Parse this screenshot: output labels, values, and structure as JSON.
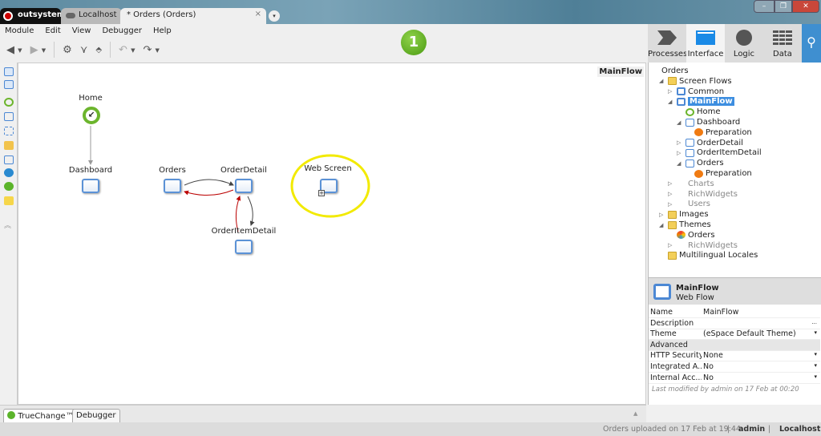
{
  "window": {
    "tabs": [
      {
        "label": "outsystems"
      },
      {
        "label": "Localhost"
      },
      {
        "label": "* Orders (Orders)"
      }
    ],
    "close_tab": "×",
    "more": "▾",
    "controls": [
      "–",
      "❐",
      "✕"
    ]
  },
  "menu": [
    "Module",
    "Edit",
    "View",
    "Debugger",
    "Help"
  ],
  "toolbar": {
    "publish_number": "1",
    "icons": [
      "back-icon",
      "forward-icon",
      "settings-icon",
      "compare-icon",
      "merge-icon",
      "undo-icon",
      "redo-icon"
    ]
  },
  "right_tabs": [
    {
      "label": "Processes"
    },
    {
      "label": "Interface",
      "selected": true
    },
    {
      "label": "Logic"
    },
    {
      "label": "Data"
    }
  ],
  "search_icon": "search-icon",
  "canvas": {
    "flow_label": "MainFlow",
    "nodes": [
      "Home",
      "Dashboard",
      "Orders",
      "OrderDetail",
      "OrderItemDetail",
      "Web Screen"
    ],
    "highlight_color": "#f2ea00"
  },
  "tree": [
    {
      "label": "Orders",
      "icon": "module"
    },
    {
      "label": "Screen Flows",
      "icon": "folder"
    },
    {
      "label": "Common",
      "icon": "flow"
    },
    {
      "label": "MainFlow",
      "icon": "flow",
      "selected": true
    },
    {
      "label": "Home",
      "icon": "home"
    },
    {
      "label": "Dashboard",
      "icon": "screen"
    },
    {
      "label": "Preparation",
      "icon": "prep"
    },
    {
      "label": "OrderDetail",
      "icon": "screen"
    },
    {
      "label": "OrderItemDetail",
      "icon": "screen"
    },
    {
      "label": "Orders",
      "icon": "screen"
    },
    {
      "label": "Preparation",
      "icon": "prep"
    },
    {
      "label": "Charts",
      "icon": "module"
    },
    {
      "label": "RichWidgets",
      "icon": "module"
    },
    {
      "label": "Users",
      "icon": "module"
    },
    {
      "label": "Images",
      "icon": "folder"
    },
    {
      "label": "Themes",
      "icon": "folder"
    },
    {
      "label": "Orders",
      "icon": "theme"
    },
    {
      "label": "RichWidgets",
      "icon": "module"
    },
    {
      "label": "Multilingual Locales",
      "icon": "folder"
    }
  ],
  "properties": {
    "title": "MainFlow",
    "subtitle": "Web Flow",
    "rows": [
      {
        "key": "Name",
        "value": "MainFlow"
      },
      {
        "key": "Description",
        "value": "",
        "extra": "..."
      },
      {
        "key": "Theme",
        "value": "(eSpace Default Theme)",
        "extra": "▾"
      },
      {
        "key": "Advanced",
        "section": true
      },
      {
        "key": "HTTP Security",
        "value": "None",
        "extra": "▾"
      },
      {
        "key": "Integrated A...",
        "value": "No",
        "extra": "▾"
      },
      {
        "key": "Internal Acc...",
        "value": "No",
        "extra": "▾"
      }
    ],
    "last_modified": "Last modified by admin on 17 Feb at 00:20"
  },
  "bottom_tabs": [
    "TrueChange™",
    "Debugger"
  ],
  "status": {
    "message": "Orders uploaded on 17 Feb at 19:44",
    "user": "admin",
    "server": "Localhost",
    "sep": "|"
  }
}
